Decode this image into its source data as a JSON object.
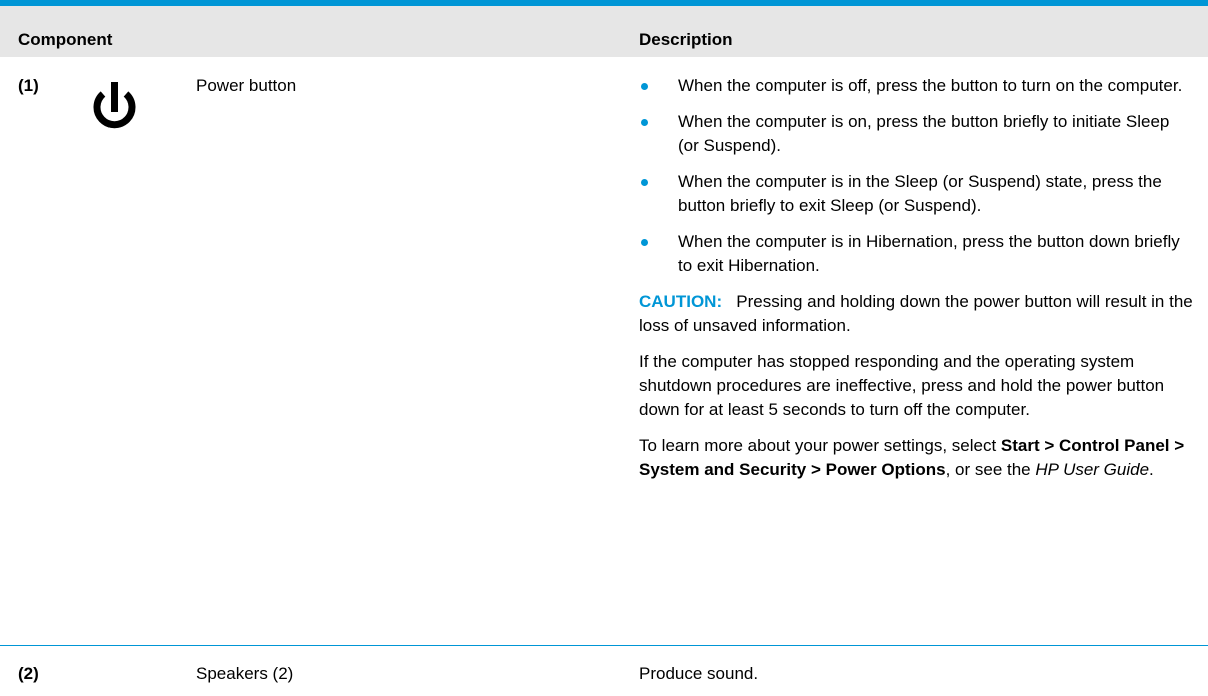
{
  "header": {
    "component": "Component",
    "description": "Description"
  },
  "rows": [
    {
      "number": "(1)",
      "icon": "power-icon",
      "name": "Power button",
      "bullets": [
        "When the computer is off, press the button to turn on the computer.",
        "When the computer is on, press the button briefly to initiate Sleep (or Suspend).",
        "When the computer is in the Sleep (or Suspend) state, press the button briefly to exit Sleep (or Suspend).",
        "When the computer is in Hibernation, press the button down briefly to exit Hibernation."
      ],
      "caution_label": "CAUTION:",
      "caution_text": "Pressing and holding down the power button will result in the loss of unsaved information.",
      "paragraph": "If the computer has stopped responding and the operating system shutdown procedures are ineffective, press and hold the power button down for at least 5 seconds to turn off the computer.",
      "learn_more": {
        "prefix": "To learn more about your power settings, select ",
        "path": "Start > Control Panel > System and Security > Power Options",
        "middle": ", or see the ",
        "guide": "HP User Guide",
        "suffix": "."
      }
    },
    {
      "number": "(2)",
      "name": "Speakers (2)",
      "description": "Produce sound."
    }
  ],
  "colors": {
    "accent": "#0096d6",
    "header_bg": "#e6e6e6"
  }
}
